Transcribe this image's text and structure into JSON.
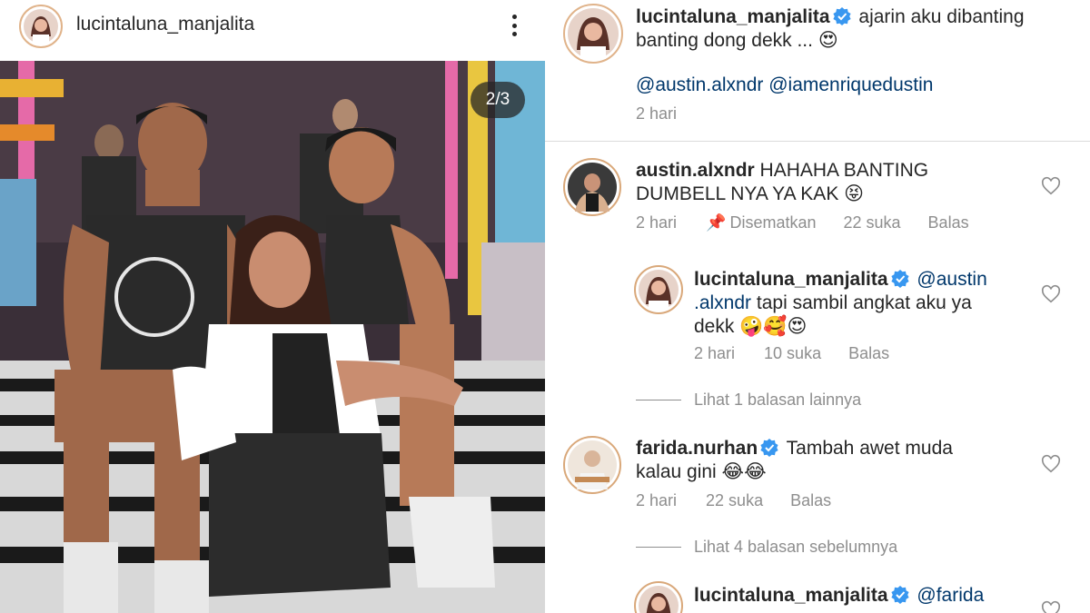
{
  "post": {
    "username": "lucintaluna_manjalita",
    "image_counter": "2/3"
  },
  "caption": {
    "username": "lucintaluna_manjalita",
    "text": "ajarin aku dibanting banting dong dekk ... 😍",
    "mentions": "@austin.alxndr @iamenriquedustin",
    "time": "2 hari"
  },
  "comments": [
    {
      "username": "austin.alxndr",
      "text": "HAHAHA BANTING DUMBELL NYA YA KAK 😝",
      "time": "2 hari",
      "pinned": "Disematkan",
      "likes": "22 suka",
      "reply": "Balas"
    },
    {
      "username": "lucintaluna_manjalita",
      "mention": "@austin .alxndr",
      "text": "tapi sambil angkat aku ya dekk 🤪🥰😍",
      "time": "2 hari",
      "likes": "10 suka",
      "reply": "Balas",
      "view_more": "Lihat 1 balasan lainnya"
    },
    {
      "username": "farida.nurhan",
      "text": "Tambah awet muda kalau gini 😂😂",
      "time": "2 hari",
      "likes": "22 suka",
      "reply": "Balas",
      "view_more": "Lihat 4 balasan sebelumnya"
    },
    {
      "username": "lucintaluna_manjalita",
      "mention": "@farida"
    }
  ],
  "colors": {
    "verified": "#3897f0",
    "mention": "#00376b",
    "meta": "#8e8e8e"
  }
}
